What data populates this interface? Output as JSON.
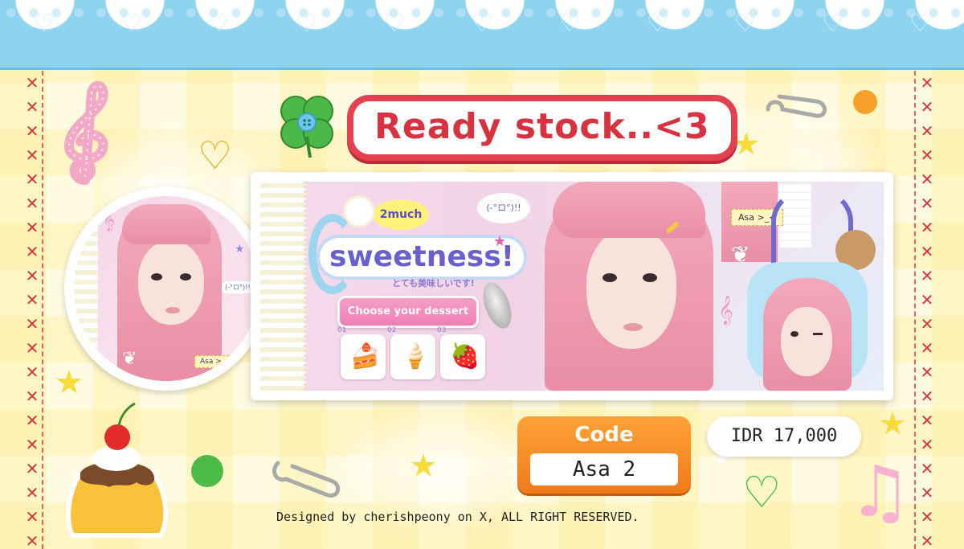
{
  "title": "Ready stock..<3",
  "banner": {
    "much_tag": "2much",
    "headline": "sweetness!",
    "jp_subtitle": "とても美味しいです!",
    "kaomoji": "(-°ロ°)!!",
    "choose_button": "Choose your dessert",
    "desserts": [
      {
        "num": "01",
        "icon": "cake-slice-icon",
        "glyph": "🍰"
      },
      {
        "num": "02",
        "icon": "crepe-icon",
        "glyph": "🍦"
      },
      {
        "num": "03",
        "icon": "sandwich-icon",
        "glyph": "🍓"
      }
    ],
    "name_tag": "Asa >_<"
  },
  "circle_photo": {
    "name_tag": "Asa >_<",
    "kaomoji": "(-°ロ°)!!"
  },
  "code": {
    "label": "Code",
    "value": "Asa 2"
  },
  "price": "IDR 17,000",
  "credit": "Designed by cherishpeony on X, ALL RIGHT RESERVED.",
  "colors": {
    "lace_blue": "#8fd3f1",
    "title_red": "#e5404f",
    "code_orange": "#f48a26",
    "background": "#fffbe0"
  }
}
